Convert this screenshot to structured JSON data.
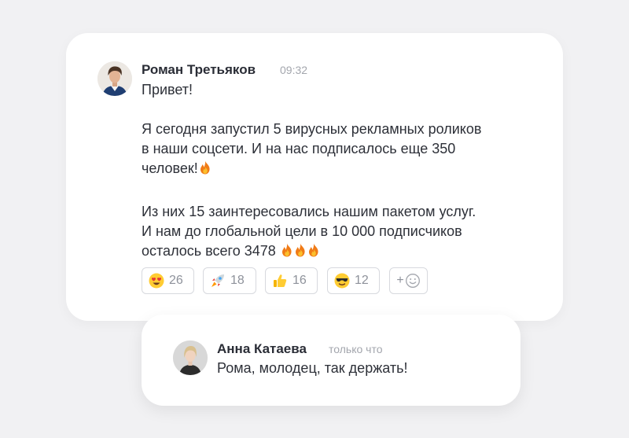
{
  "message": {
    "author": "Роман Третьяков",
    "time": "09:32",
    "lines": [
      "Привет!",
      "Я сегодня запустил 5 вирусных рекламных роликов",
      "в наши соцсети. И на нас подписалось еще 350",
      "человек!",
      "Из них 15 заинтересовались нашим пакетом услуг.",
      "И нам до глобальной цели в 10 000 подписчиков",
      "осталось всего 3478"
    ],
    "reactions": [
      {
        "icon": "heart-eyes-emoji",
        "count": "26"
      },
      {
        "icon": "rocket-emoji",
        "count": "18"
      },
      {
        "icon": "thumbs-up-emoji",
        "count": "16"
      },
      {
        "icon": "sunglasses-emoji",
        "count": "12"
      }
    ],
    "add_reaction_label": "+"
  },
  "reply": {
    "author": "Анна Катаева",
    "time": "только что",
    "text": "Рома, молодец, так держать!"
  },
  "colors": {
    "background": "#f1f1f3",
    "card": "#ffffff",
    "name": "#2a2d36",
    "muted": "#a3a6ad",
    "border": "#d7d9de"
  }
}
